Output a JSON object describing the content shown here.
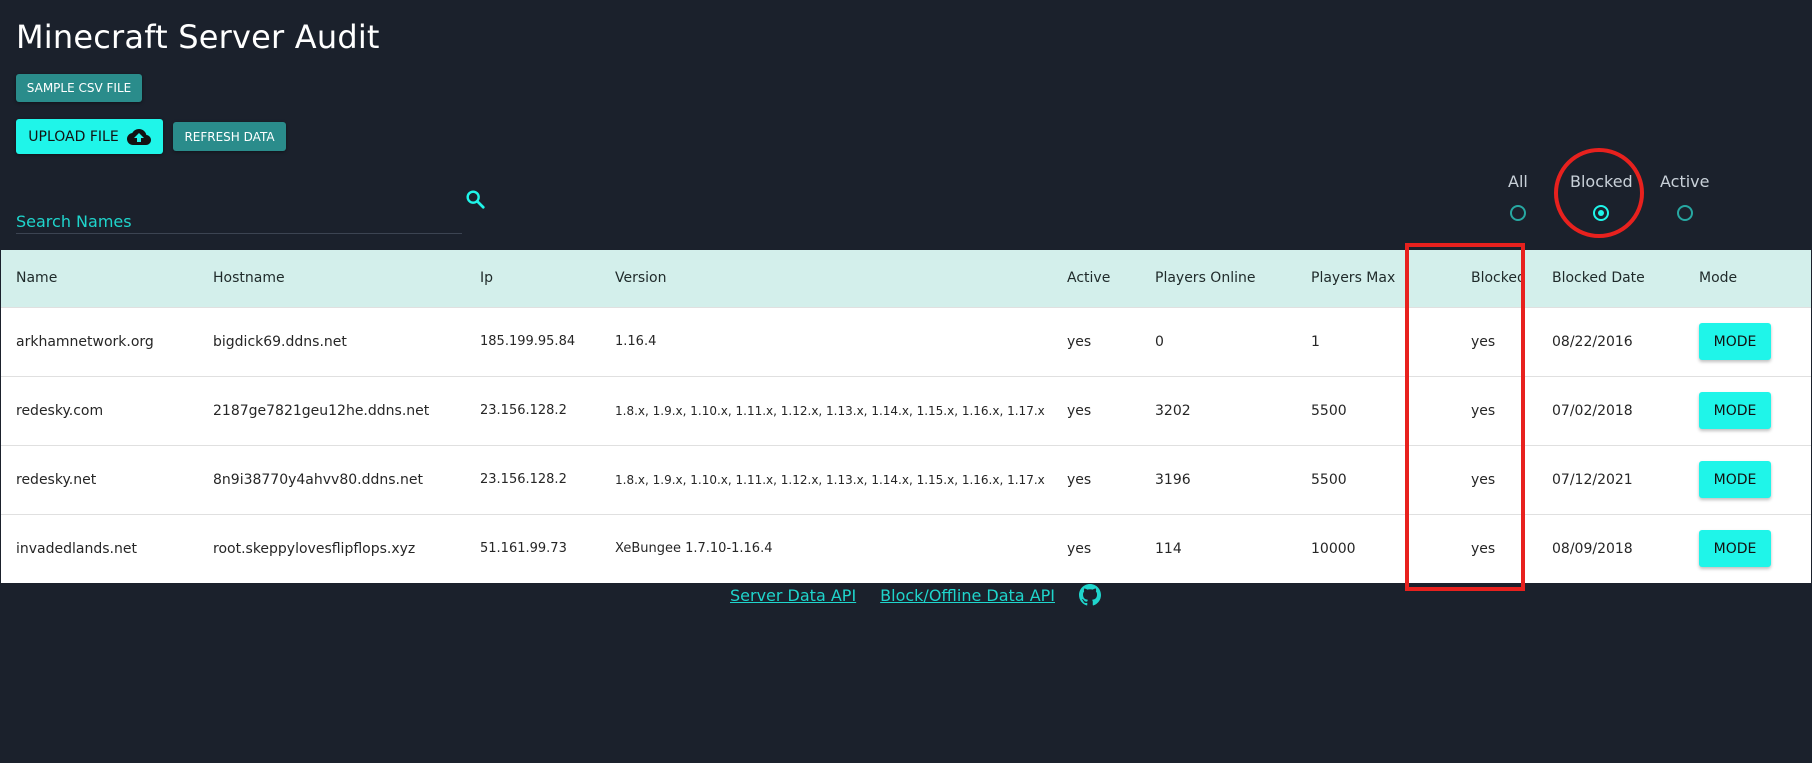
{
  "app": {
    "title": "Minecraft Server Audit"
  },
  "toolbar": {
    "sample_csv_label": "SAMPLE CSV FILE",
    "upload_label": "UPLOAD FILE",
    "refresh_label": "REFRESH DATA"
  },
  "search": {
    "placeholder": "Search Names",
    "icon": "search-icon"
  },
  "filter": {
    "options": [
      "All",
      "Blocked",
      "Active"
    ],
    "selected": "Blocked"
  },
  "table": {
    "columns": [
      "Name",
      "Hostname",
      "Ip",
      "Version",
      "Active",
      "Players Online",
      "Players Max",
      "Blocked",
      "Blocked Date",
      "Mode"
    ],
    "rows": [
      {
        "name": "arkhamnetwork.org",
        "hostname": "bigdick69.ddns.net",
        "ip": "185.199.95.84",
        "version": "1.16.4",
        "active": "yes",
        "players_online": "0",
        "players_max": "1",
        "blocked": "yes",
        "blocked_date": "08/22/2016",
        "mode_label": "MODE"
      },
      {
        "name": "redesky.com",
        "hostname": "2187ge7821geu12he.ddns.net",
        "ip": "23.156.128.2",
        "version": "1.8.x, 1.9.x, 1.10.x, 1.11.x, 1.12.x, 1.13.x, 1.14.x, 1.15.x, 1.16.x, 1.17.x",
        "active": "yes",
        "players_online": "3202",
        "players_max": "5500",
        "blocked": "yes",
        "blocked_date": "07/02/2018",
        "mode_label": "MODE"
      },
      {
        "name": "redesky.net",
        "hostname": "8n9i38770y4ahvv80.ddns.net",
        "ip": "23.156.128.2",
        "version": "1.8.x, 1.9.x, 1.10.x, 1.11.x, 1.12.x, 1.13.x, 1.14.x, 1.15.x, 1.16.x, 1.17.x",
        "active": "yes",
        "players_online": "3196",
        "players_max": "5500",
        "blocked": "yes",
        "blocked_date": "07/12/2021",
        "mode_label": "MODE"
      },
      {
        "name": "invadedlands.net",
        "hostname": "root.skeppylovesflipflops.xyz",
        "ip": "51.161.99.73",
        "version": "XeBungee 1.7.10-1.16.4",
        "active": "yes",
        "players_online": "114",
        "players_max": "10000",
        "blocked": "yes",
        "blocked_date": "08/09/2018",
        "mode_label": "MODE"
      }
    ]
  },
  "footer": {
    "links": [
      "Server Data API",
      "Block/Offline Data API"
    ],
    "icon": "github-icon"
  },
  "colors": {
    "background": "#1b212c",
    "accent": "#1ff5e9",
    "button_teal": "#2a8c8b",
    "table_header": "#d3efeb",
    "annotation": "#e8211e"
  }
}
